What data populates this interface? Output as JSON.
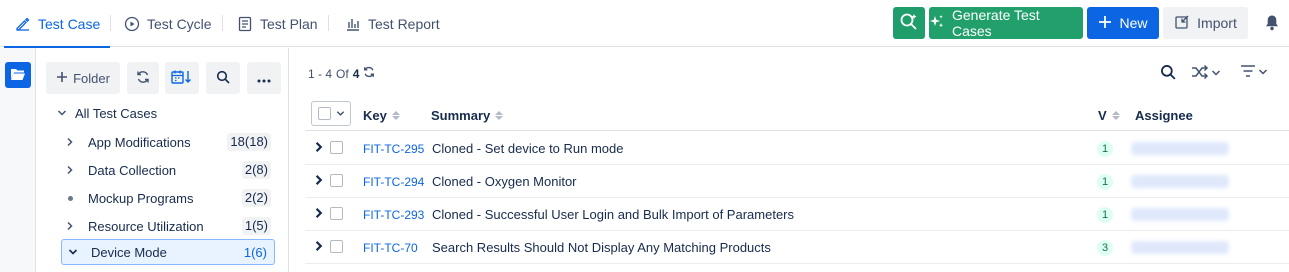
{
  "tabs": [
    {
      "label": "Test Case",
      "icon": "edit-icon",
      "active": true
    },
    {
      "label": "Test Cycle",
      "icon": "play-circle-icon",
      "active": false
    },
    {
      "label": "Test Plan",
      "icon": "document-icon",
      "active": false
    },
    {
      "label": "Test Report",
      "icon": "bar-chart-icon",
      "active": false
    }
  ],
  "actions": {
    "generate_label": "Generate Test Cases",
    "new_label": "New",
    "import_label": "Import"
  },
  "folder_toolbar": {
    "folder_label": "Folder"
  },
  "tree": {
    "root_label": "All Test Cases",
    "items": [
      {
        "label": "App Modifications",
        "count": "18(18)",
        "has_children": true,
        "selected": false
      },
      {
        "label": "Data Collection",
        "count": "2(8)",
        "has_children": true,
        "selected": false
      },
      {
        "label": "Mockup Programs",
        "count": "2(2)",
        "has_children": false,
        "selected": false
      },
      {
        "label": "Resource Utilization",
        "count": "1(5)",
        "has_children": true,
        "selected": false
      },
      {
        "label": "Device Mode",
        "count": "1(6)",
        "has_children": true,
        "selected": true
      }
    ]
  },
  "pager": {
    "range": "1 - 4",
    "of_label": "Of",
    "total": "4"
  },
  "table": {
    "columns": {
      "key": "Key",
      "summary": "Summary",
      "version": "V",
      "assignee": "Assignee"
    },
    "rows": [
      {
        "key": "FIT-TC-295",
        "summary": "Cloned - Set device to Run mode",
        "version": "1"
      },
      {
        "key": "FIT-TC-294",
        "summary": "Cloned - Oxygen Monitor",
        "version": "1"
      },
      {
        "key": "FIT-TC-293",
        "summary": "Cloned - Successful User Login and Bulk Import of Parameters",
        "version": "1"
      },
      {
        "key": "FIT-TC-70",
        "summary": "Search Results Should Not Display Any Matching Products",
        "version": "3"
      }
    ]
  },
  "colors": {
    "accent": "#0c66e4",
    "generate_green": "#22a06b",
    "version_badge": "#dcfff1"
  }
}
